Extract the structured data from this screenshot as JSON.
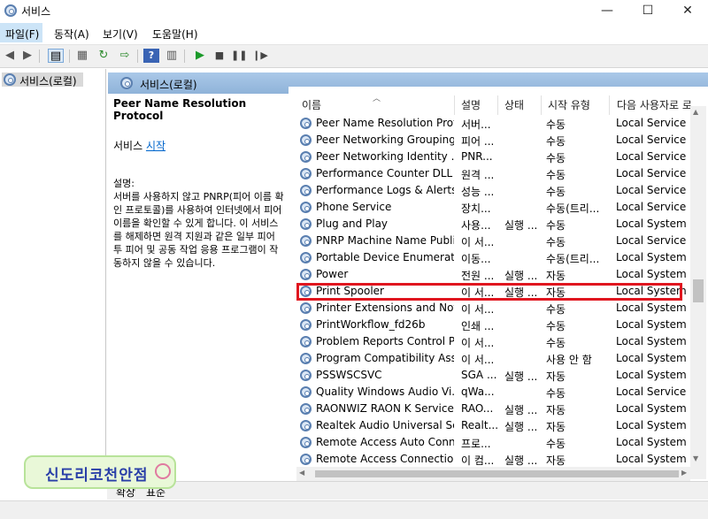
{
  "window": {
    "title": "서비스",
    "minimize": "—",
    "maximize": "☐",
    "close": "✕"
  },
  "menu": [
    {
      "label": "파일(F)"
    },
    {
      "label": "동작(A)"
    },
    {
      "label": "보기(V)"
    },
    {
      "label": "도움말(H)"
    }
  ],
  "tree": {
    "item": "서비스(로컬)"
  },
  "header": {
    "title": "서비스(로컬)"
  },
  "description": {
    "service_name": "Peer Name Resolution Protocol",
    "start_prefix": "서비스 ",
    "start_link": "시작",
    "label": "설명:",
    "text": "서버를 사용하지 않고 PNRP(피어 이름 확인 프로토콜)를 사용하여 인터넷에서 피어 이름을 확인할 수 있게 합니다. 이 서비스를 해제하면 원격 지원과 같은 일부 피어 투 피어 및 공동 작업 응용 프로그램이 작동하지 않을 수 있습니다."
  },
  "columns": {
    "name": "이름",
    "desc": "설명",
    "status": "상태",
    "startup": "시작 유형",
    "logon": "다음 사용자로 로"
  },
  "rows": [
    {
      "name": "Peer Name Resolution Prot...",
      "desc": "서버...",
      "status": "",
      "startup": "수동",
      "logon": "Local Service"
    },
    {
      "name": "Peer Networking Grouping",
      "desc": "피어 ...",
      "status": "",
      "startup": "수동",
      "logon": "Local Service"
    },
    {
      "name": "Peer Networking Identity ...",
      "desc": "PNR...",
      "status": "",
      "startup": "수동",
      "logon": "Local Service"
    },
    {
      "name": "Performance Counter DLL ...",
      "desc": "원격 ...",
      "status": "",
      "startup": "수동",
      "logon": "Local Service"
    },
    {
      "name": "Performance Logs & Alerts",
      "desc": "성능 ...",
      "status": "",
      "startup": "수동",
      "logon": "Local Service"
    },
    {
      "name": "Phone Service",
      "desc": "장치...",
      "status": "",
      "startup": "수동(트리...",
      "logon": "Local Service"
    },
    {
      "name": "Plug and Play",
      "desc": "사용...",
      "status": "실행 ...",
      "startup": "수동",
      "logon": "Local System"
    },
    {
      "name": "PNRP Machine Name Publi...",
      "desc": "이 서...",
      "status": "",
      "startup": "수동",
      "logon": "Local Service"
    },
    {
      "name": "Portable Device Enumerato...",
      "desc": "이동...",
      "status": "",
      "startup": "수동(트리...",
      "logon": "Local System"
    },
    {
      "name": "Power",
      "desc": "전원 ...",
      "status": "실행 ...",
      "startup": "자동",
      "logon": "Local System"
    },
    {
      "name": "Print Spooler",
      "desc": "이 서...",
      "status": "실행 ...",
      "startup": "자동",
      "logon": "Local System"
    },
    {
      "name": "Printer Extensions and Noti...",
      "desc": "이 서...",
      "status": "",
      "startup": "수동",
      "logon": "Local System"
    },
    {
      "name": "PrintWorkflow_fd26b",
      "desc": "인쇄 ...",
      "status": "",
      "startup": "수동",
      "logon": "Local System"
    },
    {
      "name": "Problem Reports Control P...",
      "desc": "이 서...",
      "status": "",
      "startup": "수동",
      "logon": "Local System"
    },
    {
      "name": "Program Compatibility Assi...",
      "desc": "이 서...",
      "status": "",
      "startup": "사용 안 함",
      "logon": "Local System"
    },
    {
      "name": "PSSWSCSVC",
      "desc": "SGA ...",
      "status": "실행 ...",
      "startup": "자동",
      "logon": "Local System"
    },
    {
      "name": "Quality Windows Audio Vi...",
      "desc": "qWa...",
      "status": "",
      "startup": "수동",
      "logon": "Local Service"
    },
    {
      "name": "RAONWIZ RAON K Service",
      "desc": "RAO...",
      "status": "실행 ...",
      "startup": "자동",
      "logon": "Local System"
    },
    {
      "name": "Realtek Audio Universal Ser...",
      "desc": "Realt...",
      "status": "실행 ...",
      "startup": "자동",
      "logon": "Local System"
    },
    {
      "name": "Remote Access Auto Conn...",
      "desc": "프로...",
      "status": "",
      "startup": "수동",
      "logon": "Local System"
    },
    {
      "name": "Remote Access Connection...",
      "desc": "이 컴...",
      "status": "실행 ...",
      "startup": "자동",
      "logon": "Local System"
    }
  ],
  "tabs": {
    "extended": "확장",
    "standard": "표준"
  },
  "badge": {
    "text": "신도리코천안점"
  },
  "colors": {
    "highlight": "#e0161f",
    "link": "#0066cc",
    "header_band": "#9dbde0"
  }
}
